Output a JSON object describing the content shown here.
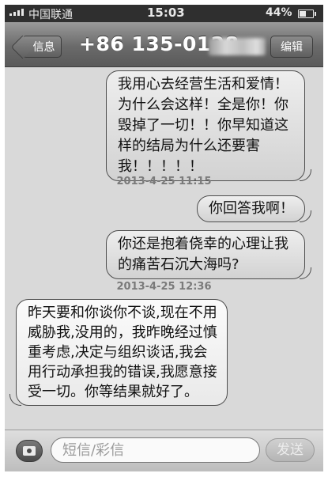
{
  "status_bar": {
    "carrier": "中国联通",
    "time": "15:03",
    "battery": "44%",
    "battery_level": 0.44,
    "signal_bars": 4
  },
  "nav": {
    "back_label": "信息",
    "contact": "+86 135-0128-",
    "edit_label": "编辑"
  },
  "messages": [
    {
      "direction": "outgoing",
      "text": "我用心去经营生活和爱情！为什么会这样！全是你！你毁掉了一切！！你早知道这样的结局为什么还要害我！！！！！"
    },
    {
      "direction": "outgoing",
      "text": "你回答我啊！"
    },
    {
      "direction": "outgoing",
      "text": "你还是抱着侥幸的心理让我的痛苦石沉大海吗?"
    },
    {
      "direction": "incoming",
      "text": "昨天要和你谈你不谈,现在不用威胁我,没用的，我昨晚经过慎重考虑,决定与组织谈话,我会用行动承担我的错误,我愿意接受一切。你等结果就好了。"
    }
  ],
  "timestamps": [
    "2013-4-25 11:15",
    "2013-4-25 12:36"
  ],
  "compose": {
    "placeholder": "短信/彩信",
    "send_label": "发送"
  }
}
